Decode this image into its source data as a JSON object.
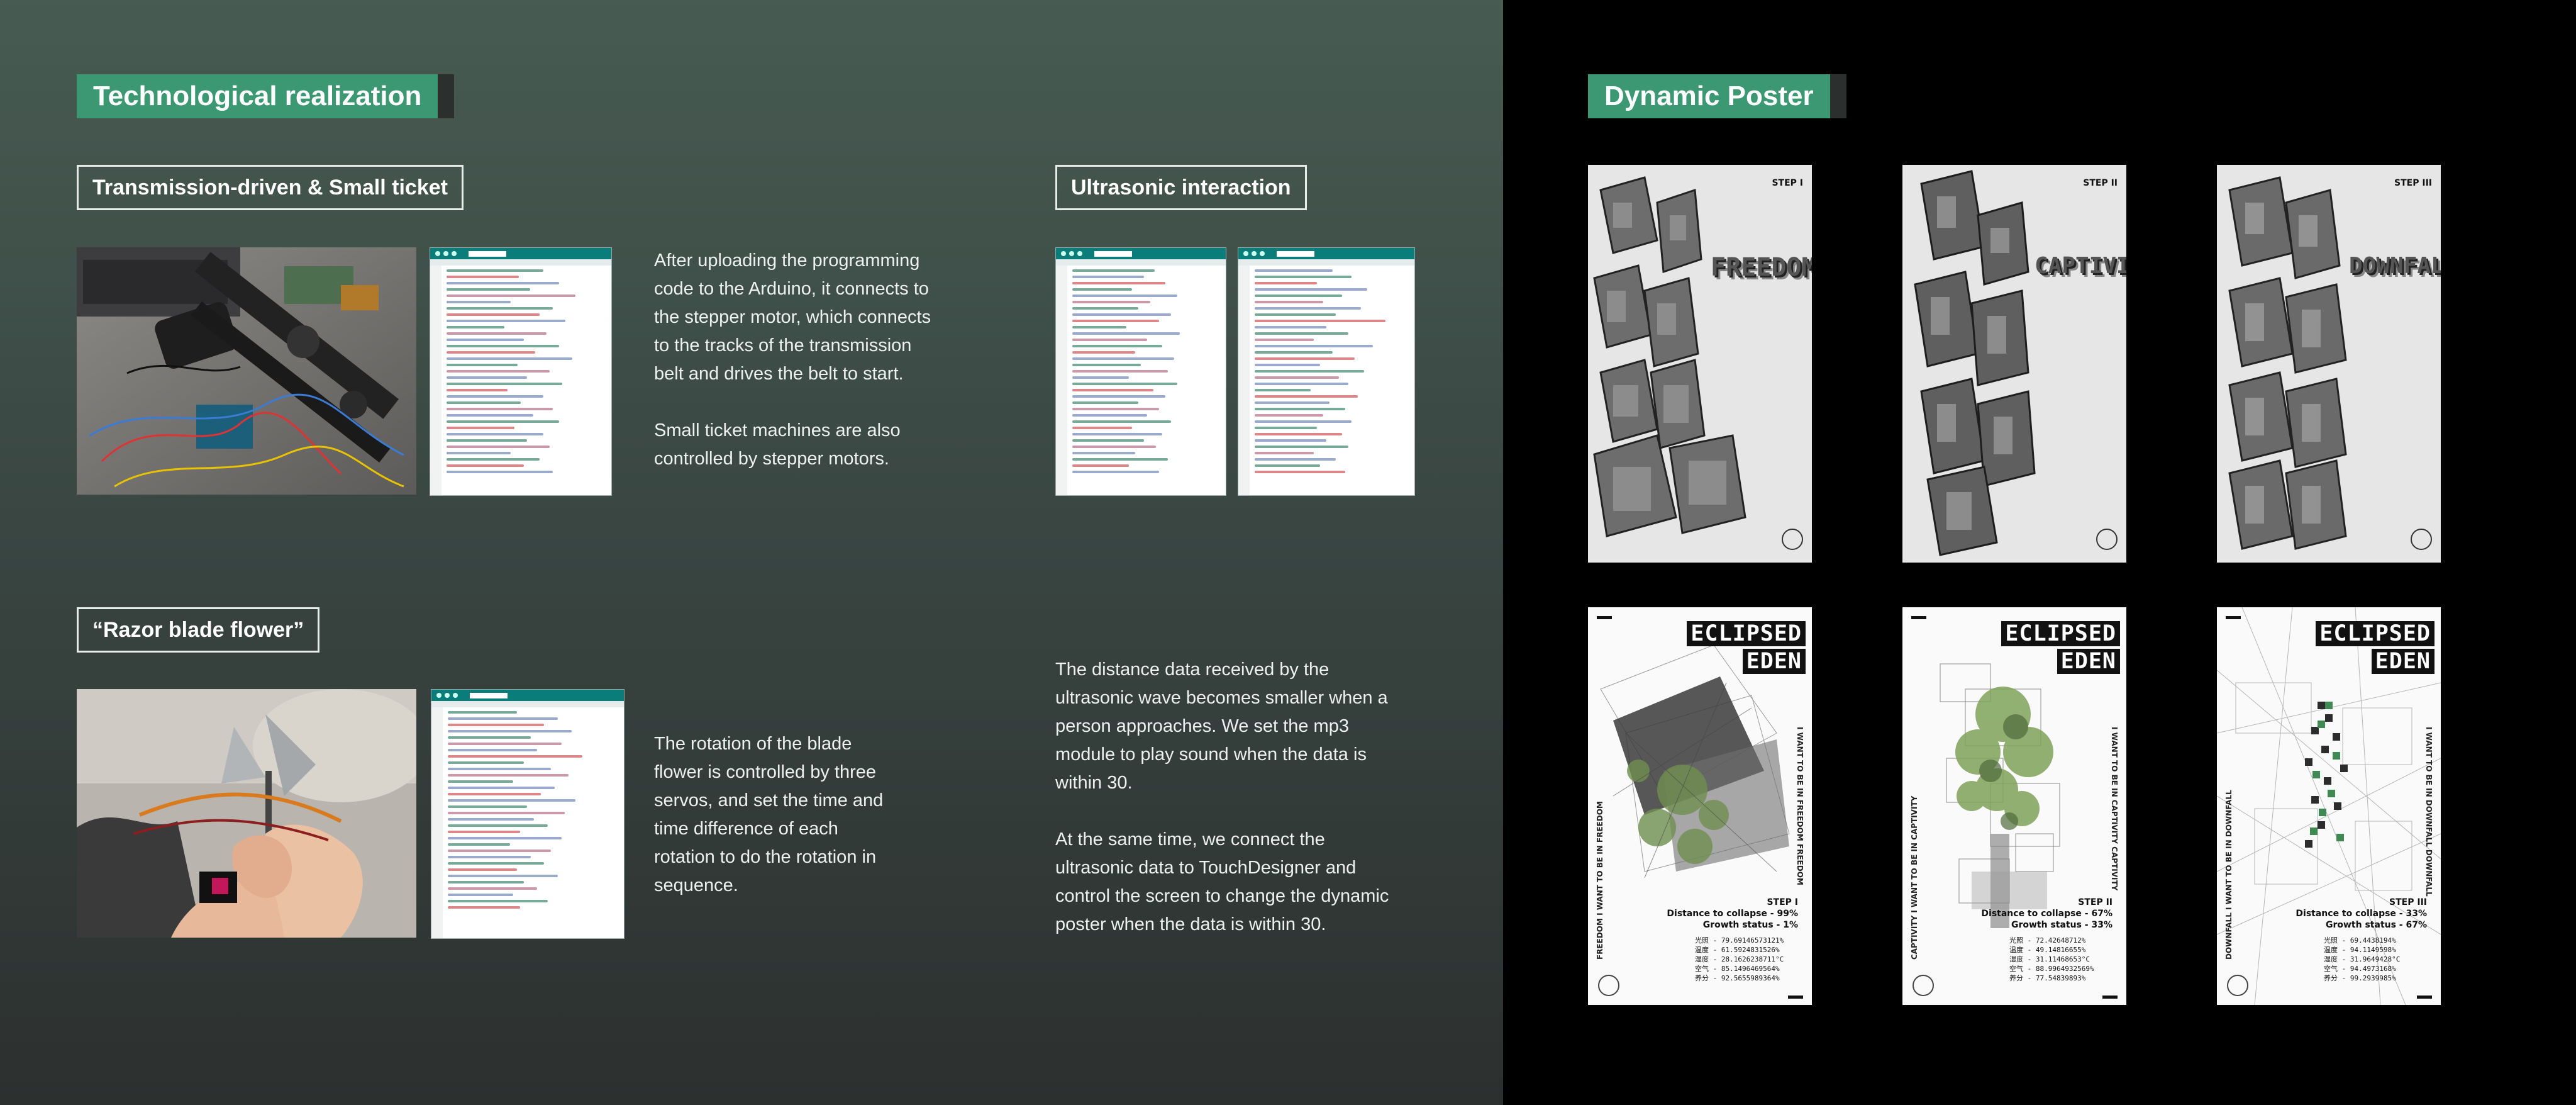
{
  "left_section": {
    "title": "Technological realization",
    "transmission": {
      "heading": "Transmission-driven & Small ticket",
      "text": "After uploading the programming\ncode to the Arduino, it connects to\nthe stepper motor, which connects\nto the tracks of the transmission\nbelt and drives the belt to start.\n\nSmall ticket machines are also\ncontrolled by stepper motors.",
      "photo_icon": "stepper-belt-photo",
      "code_icon": "arduino-code-screenshot"
    },
    "ultrasonic": {
      "heading": "Ultrasonic interaction",
      "text": "The distance data received by the\nultrasonic wave becomes smaller when a\nperson approaches. We set the mp3\nmodule to play sound when the data is\nwithin 30.\n\nAt the same time, we connect the\nultrasonic data to TouchDesigner and\ncontrol the screen to change the dynamic\nposter when the data is within 30."
    },
    "razor": {
      "heading": "“Razor blade flower”",
      "text": "The rotation of the blade\nflower is controlled by three\nservos, and set the time and\ntime difference of each\nrotation to do the rotation in\nsequence."
    }
  },
  "right_section": {
    "title": "Dynamic Poster",
    "top_posters": [
      {
        "step": "STEP I",
        "word": "FREEDOM",
        "header": "ECLIPSED EDEN"
      },
      {
        "step": "STEP II",
        "word": "CAPTIVITY",
        "header": "ECLIPSED EDEN"
      },
      {
        "step": "STEP III",
        "word": "DOWNFALL",
        "header": "ECLIPSED EDEN"
      }
    ],
    "bottom_posters": [
      {
        "title_line1": "ECLIPSED",
        "title_line2": "EDEN",
        "step": "STEP I",
        "collapse": "Distance to collapse - 99%",
        "growth": "Growth status - 1%",
        "side_left": "FREEDOM   I WANT TO BE IN FREEDOM",
        "side_right": "I WANT TO BE IN FREEDOM   FREEDOM",
        "readings": "光照 - 79.69146573121%\n温度 - 61.5924831526%\n湿度 - 28.1626238711°C\n空气 - 85.1496469564%\n养分 - 92.5655989364%"
      },
      {
        "title_line1": "ECLIPSED",
        "title_line2": "EDEN",
        "step": "STEP II",
        "collapse": "Distance to collapse - 67%",
        "growth": "Growth status - 33%",
        "side_left": "CAPTIVITY   I WANT TO BE IN CAPTIVITY",
        "side_right": "I WANT TO BE IN CAPTIVITY   CAPTIVITY",
        "readings": "光照 - 72.42648712%\n温度 - 49.14816655%\n湿度 - 31.11468653°C\n空气 - 88.9964932569%\n养分 - 77.54839893%"
      },
      {
        "title_line1": "ECLIPSED",
        "title_line2": "EDEN",
        "step": "STEP III",
        "collapse": "Distance to collapse - 33%",
        "growth": "Growth status - 67%",
        "side_left": "DOWNFALL   I WANT TO BE IN DOWNFALL",
        "side_right": "I WANT TO BE IN DOWNFALL   DOWNFALL",
        "readings": "光照 - 69.4438194%\n温度 - 94.1149598%\n湿度 - 31.9649428°C\n空气 - 94.4973168%\n养分 - 99.2939985%"
      }
    ]
  },
  "colors": {
    "accent": "#3b9873",
    "left_bg_top": "#475b52",
    "left_bg_bottom": "#2c302f",
    "right_bg": "#000000",
    "code_bar": "#0a7c7a"
  }
}
